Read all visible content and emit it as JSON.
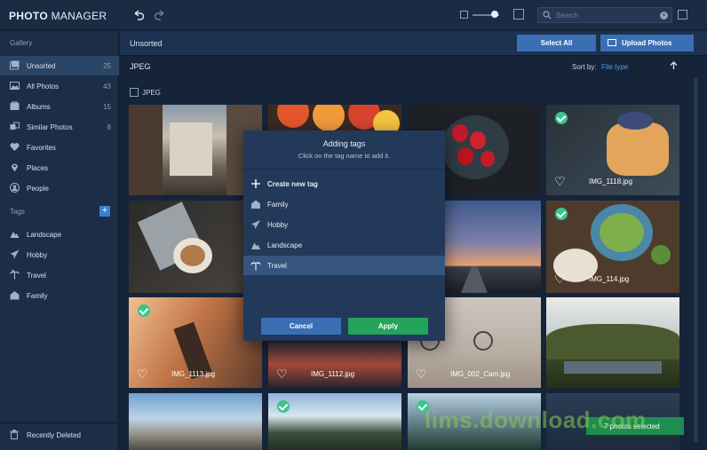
{
  "app": {
    "logo_bold": "PHOTO",
    "logo_thin": " MANAGER"
  },
  "search": {
    "placeholder": "Search",
    "value": ""
  },
  "sidebar": {
    "gallery_title": "Gallery",
    "gallery_items": [
      {
        "label": "Unsorted",
        "count": "25",
        "icon": "unsorted-icon"
      },
      {
        "label": "All Photos",
        "count": "43",
        "icon": "photos-icon"
      },
      {
        "label": "Albums",
        "count": "15",
        "icon": "album-icon"
      },
      {
        "label": "Similar Photos",
        "count": "8",
        "icon": "similar-icon"
      },
      {
        "label": "Favorites",
        "count": "",
        "icon": "heart-icon"
      },
      {
        "label": "Places",
        "count": "",
        "icon": "pin-icon"
      },
      {
        "label": "People",
        "count": "",
        "icon": "person-icon"
      }
    ],
    "tags_title": "Tags",
    "tag_items": [
      {
        "label": "Landscape",
        "icon": "landscape-icon"
      },
      {
        "label": "Hobby",
        "icon": "paper-plane-icon"
      },
      {
        "label": "Travel",
        "icon": "palm-tree-icon"
      },
      {
        "label": "Family",
        "icon": "family-icon"
      }
    ],
    "recently_deleted": "Recently Deleted"
  },
  "main": {
    "title": "Unsorted",
    "select_all": "Select All",
    "upload": "Upload Photos",
    "format": "JPEG",
    "sort_by_label": "Sort by:",
    "sort_by_value": "File type",
    "group_label": "JPEG"
  },
  "photos": [
    {
      "name": "",
      "selected": false,
      "heart": false
    },
    {
      "name": "",
      "selected": false,
      "heart": false
    },
    {
      "name": "",
      "selected": false,
      "heart": false
    },
    {
      "name": "IMG_1118.jpg",
      "selected": true,
      "heart": true
    },
    {
      "name": "",
      "selected": false,
      "heart": false
    },
    {
      "name": "",
      "selected": false,
      "heart": false
    },
    {
      "name": "IMG_114.jpg",
      "selected": true,
      "heart": true
    },
    {
      "name": "IMG_1113.jpg",
      "selected": true,
      "heart": true
    },
    {
      "name": "IMG_1112.jpg",
      "selected": false,
      "heart": true
    },
    {
      "name": "IMG_002_Cam.jpg",
      "selected": false,
      "heart": true
    },
    {
      "name": "",
      "selected": false,
      "heart": false
    },
    {
      "name": "",
      "selected": false,
      "heart": false
    },
    {
      "name": "",
      "selected": true,
      "heart": false
    },
    {
      "name": "",
      "selected": true,
      "heart": false
    }
  ],
  "modal": {
    "title": "Adding tags",
    "subtitle": "Click on the tag name to add it.",
    "create_label": "Create new tag",
    "tags": [
      {
        "label": "Family",
        "icon": "family-icon",
        "active": false
      },
      {
        "label": "Hobby",
        "icon": "paper-plane-icon",
        "active": false
      },
      {
        "label": "Landscape",
        "icon": "landscape-icon",
        "active": false
      },
      {
        "label": "Travel",
        "icon": "palm-tree-icon",
        "active": true
      }
    ],
    "cancel": "Cancel",
    "apply": "Apply"
  },
  "toast": "7 photos selected",
  "watermark": "lims.download.com",
  "colors": {
    "accent_blue": "#3a6fb4",
    "apply_green": "#23a35b",
    "select_green": "#37c68d",
    "link_blue": "#4f9be8"
  }
}
